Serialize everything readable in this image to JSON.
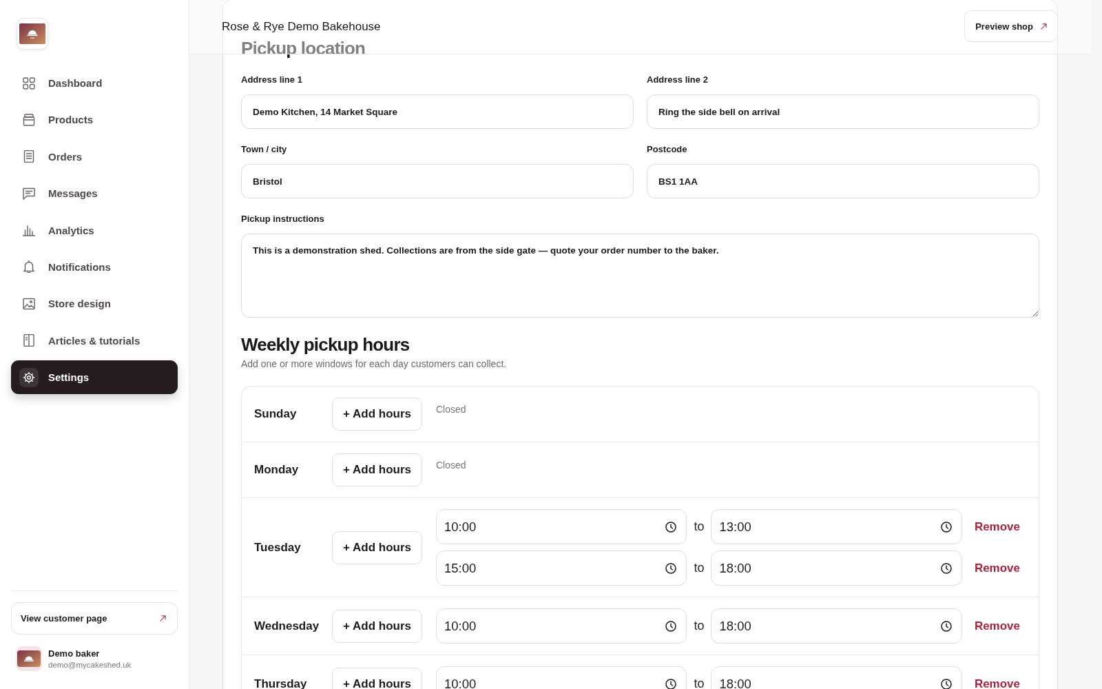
{
  "sidebar": {
    "items": [
      {
        "label": "Dashboard",
        "selected": false
      },
      {
        "label": "Products",
        "selected": false
      },
      {
        "label": "Orders",
        "selected": false
      },
      {
        "label": "Messages",
        "selected": false
      },
      {
        "label": "Analytics",
        "selected": false
      },
      {
        "label": "Notifications",
        "selected": false
      },
      {
        "label": "Store design",
        "selected": false
      },
      {
        "label": "Articles & tutorials",
        "selected": false
      },
      {
        "label": "Settings",
        "selected": true
      }
    ],
    "customer_page_link": {
      "label": "View customer page"
    },
    "user": {
      "name": "Demo baker",
      "email": "demo@mycakeshed.uk"
    }
  },
  "header": {
    "title": "Rose & Rye Demo Bakehouse",
    "preview_button": {
      "label": "Preview shop"
    }
  },
  "pickup_location": {
    "title": "Pickup location",
    "fields": [
      {
        "label": "Address line 1",
        "value": "Demo Kitchen, 14 Market Square"
      },
      {
        "label": "Address line 2",
        "value": "Ring the side bell on arrival"
      },
      {
        "label": "Town / city",
        "value": "Bristol"
      },
      {
        "label": "Postcode",
        "value": "BS1 1AA"
      }
    ],
    "instructions": {
      "label": "Pickup instructions",
      "value": "This is a demonstration shed. Collections are from the side gate — quote your order number to the baker."
    }
  },
  "weekly_hours": {
    "title": "Weekly pickup hours",
    "subtitle": "Add one or more windows for each day customers can collect.",
    "days": [
      {
        "day": "Sunday",
        "add_button": "+ Add hours",
        "status": "Closed"
      },
      {
        "day": "Monday",
        "add_button": "+ Add hours",
        "status": "Closed"
      },
      {
        "day": "Tuesday",
        "add_button": "+ Add hours",
        "windows": [
          {
            "from": "10:00",
            "separator": "to",
            "to": "13:00",
            "remove": "Remove"
          },
          {
            "from": "15:00",
            "separator": "to",
            "to": "18:00",
            "remove": "Remove"
          }
        ]
      },
      {
        "day": "Wednesday",
        "add_button": "+ Add hours",
        "windows": [
          {
            "from": "10:00",
            "separator": "to",
            "to": "18:00",
            "remove": "Remove"
          }
        ]
      },
      {
        "day": "Thursday",
        "add_button": "+ Add hours",
        "windows": [
          {
            "from": "10:00",
            "separator": "to",
            "to": "18:00",
            "remove": "Remove"
          }
        ]
      }
    ]
  }
}
